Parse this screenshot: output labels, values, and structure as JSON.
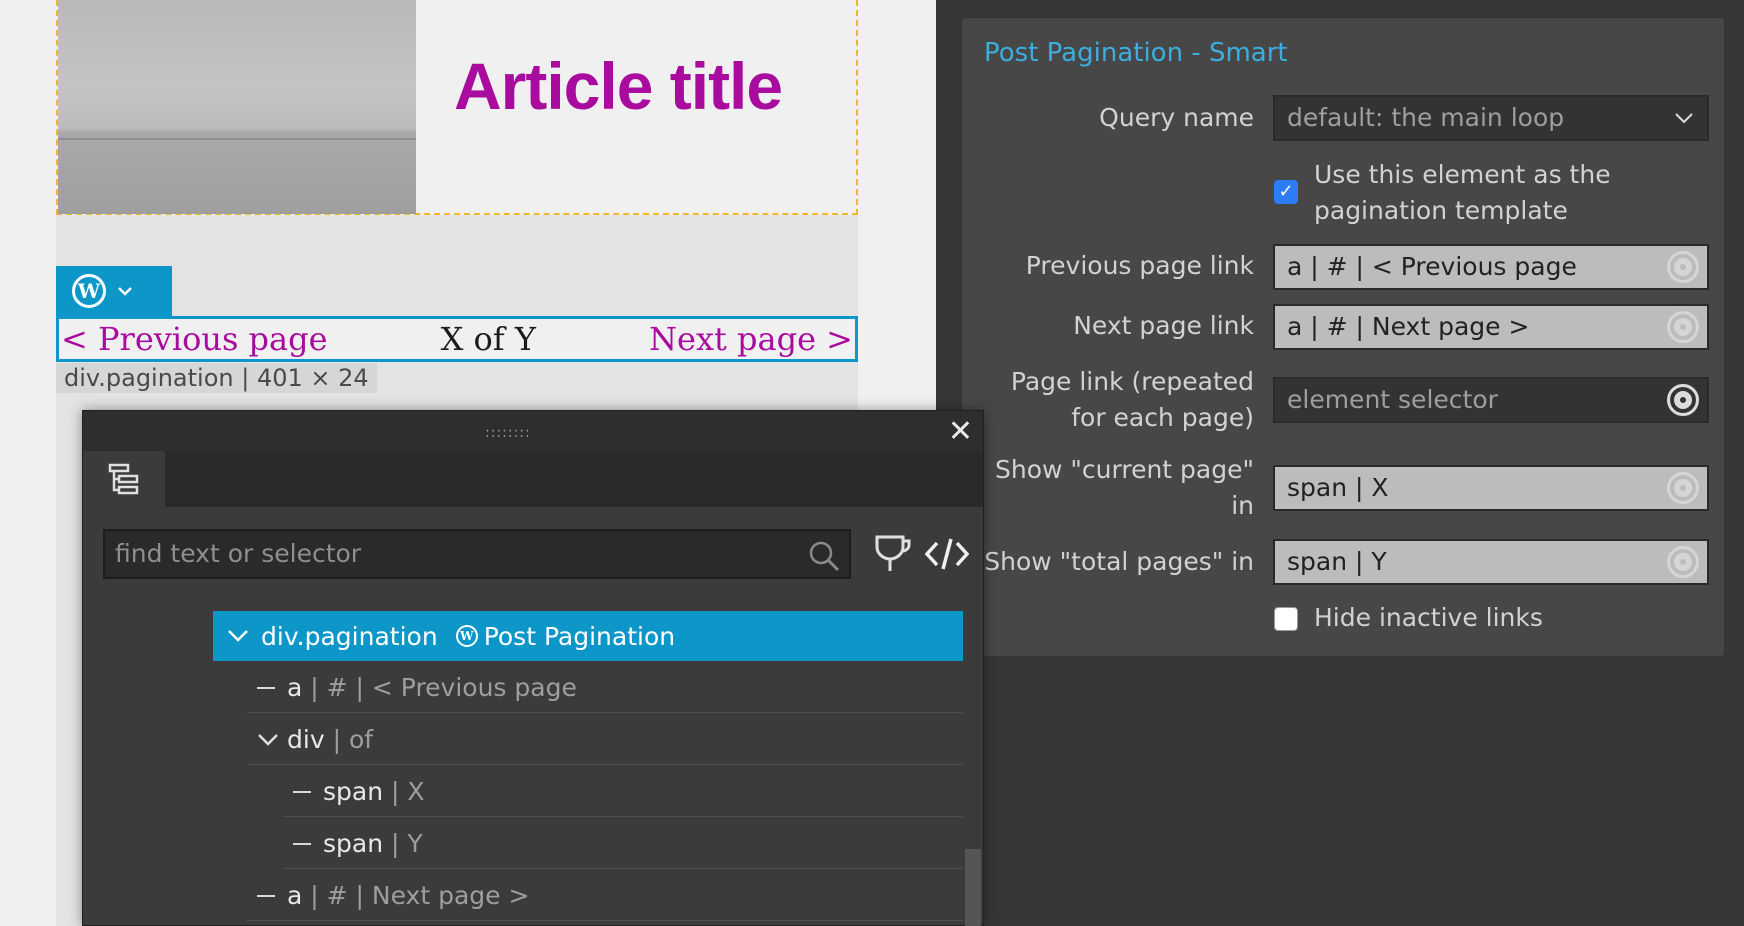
{
  "canvas": {
    "article_title": "Article title",
    "pagination": {
      "prev": "< Previous page",
      "middle": "X of Y",
      "next": "Next page >"
    },
    "element_label": "div.pagination | 401 × 24"
  },
  "settings": {
    "title": "Post Pagination - Smart",
    "query_name": {
      "label": "Query name",
      "value": "default: the main loop"
    },
    "use_template": {
      "label_line1": "Use this element as the",
      "label_line2": "pagination template",
      "checked": true
    },
    "prev_link": {
      "label": "Previous page link",
      "value": "a | # | < Previous page"
    },
    "next_link": {
      "label": "Next page link",
      "value": "a | # | Next page >"
    },
    "page_link": {
      "label_line1": "Page link (repeated",
      "label_line2": "for each page)",
      "placeholder": "element selector"
    },
    "current_page": {
      "label_line1": "Show \"current page\"",
      "label_line2": "in",
      "value": "span | X"
    },
    "total_pages": {
      "label": "Show \"total pages\" in",
      "value": "span | Y"
    },
    "hide_inactive": {
      "label": "Hide inactive links",
      "checked": false
    }
  },
  "tree": {
    "search_placeholder": "find text or selector",
    "rows": [
      {
        "tag": "div.pagination",
        "extra": "Post Pagination",
        "selected": true
      },
      {
        "tag": "a",
        "extra": "| # | < Previous page"
      },
      {
        "tag": "div",
        "extra": "| of"
      },
      {
        "tag": "span",
        "extra": "| X"
      },
      {
        "tag": "span",
        "extra": "| Y"
      },
      {
        "tag": "a",
        "extra": "| # | Next page >"
      }
    ]
  },
  "colors": {
    "accent": "#0c97c8",
    "article_title": "#a90b9f",
    "settings_title": "#3aaede",
    "checkbox_on": "#2d7cf6"
  }
}
